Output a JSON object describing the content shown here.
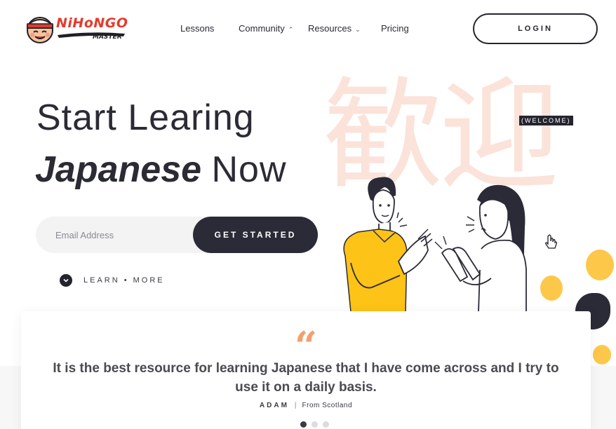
{
  "brand": {
    "logo_text": "NiHoNGO",
    "logo_subtext": "MASTER"
  },
  "nav": {
    "items": [
      {
        "label": "Lessons",
        "has_dropdown": false
      },
      {
        "label": "Community",
        "has_dropdown": true
      },
      {
        "label": "Resources",
        "has_dropdown": true
      },
      {
        "label": "Pricing",
        "has_dropdown": false
      }
    ],
    "login_label": "LOGIN"
  },
  "hero": {
    "title_line1": "Start Learing",
    "title_emphasis": "Japanese",
    "title_rest": "Now",
    "kanji": "歓迎",
    "kanji_badge": "(WELCOME)",
    "email_placeholder": "Email Address",
    "cta_label": "GET STARTED",
    "learn_more_label": "LEARN • MORE"
  },
  "testimonial": {
    "quote_mark": "“",
    "quote": "It is the best resource for learning Japanese that I have come across and I try to use it on a daily basis.",
    "author": "ADAM",
    "separator": "|",
    "origin": "From Scotland",
    "slides_total": 3,
    "active_slide": 1
  },
  "colors": {
    "accent_orange": "#f3a06f",
    "dark": "#2b2b38",
    "yellow": "#fdc316",
    "kanji_tint": "#fbe3da",
    "logo_red": "#e23b2e"
  },
  "icons": {
    "login": "none",
    "learn_more": "chevron-down-icon",
    "cursor": "hand-cursor-icon"
  }
}
